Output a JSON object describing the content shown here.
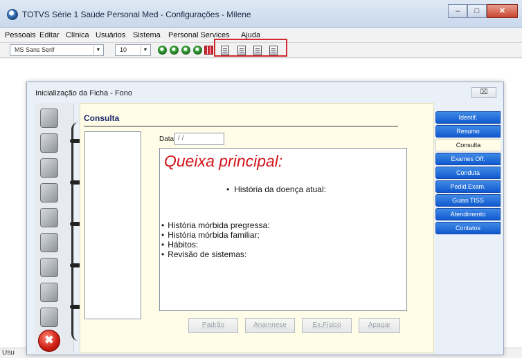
{
  "window": {
    "title": "TOTVS Série 1 Saúde Personal Med - Configurações - Milene",
    "close_glyph": "✕",
    "minimize_glyph": "–",
    "maximize_glyph": "□"
  },
  "menubar": {
    "items": [
      "Pessoais",
      "Editar",
      "Clínica",
      "Usuários",
      "Sistema",
      "Personal Services",
      "Ajuda"
    ]
  },
  "toolbar": {
    "font_name": "MS Sans Serif",
    "font_size": "10",
    "dropdown_glyph": "▼",
    "accent_color": "#d0282c"
  },
  "status": {
    "text": "Usu"
  },
  "dialog": {
    "title": "Inicialização da Ficha - Fono",
    "close_glyph": "⌧",
    "heading": "Consulta",
    "date_label": "Data",
    "date_value": "/ /",
    "editor": {
      "heading": "Queixa principal:",
      "center_item": "História da doença atual:",
      "list": [
        "História mórbida pregressa:",
        "História mórbida familiar:",
        "Hábitos:",
        "Revisão de sistemas:"
      ]
    },
    "buttons": [
      "Padrão",
      "Anamnese",
      "Ex.Físico",
      "Apagar"
    ],
    "tabs": [
      "Identif.",
      "Resumo",
      "Consulta",
      "Exames Off.",
      "Conduta",
      "Pedid.Exam.",
      "Guias TISS",
      "Atendimento",
      "Contatos"
    ],
    "active_tab": "Consulta",
    "exit_glyph": "✖"
  },
  "colors": {
    "tab_blue": "#1059cf",
    "heading_red": "#d3141b",
    "notebook_bg": "#fffde8"
  }
}
